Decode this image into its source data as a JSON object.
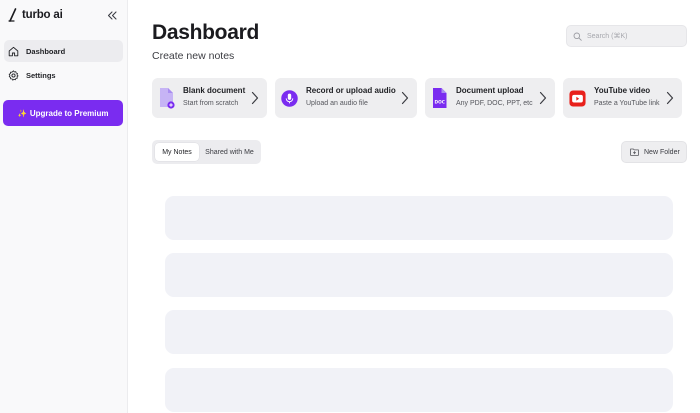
{
  "brand": {
    "name": "turbo ai"
  },
  "sidebar": {
    "items": [
      {
        "label": "Dashboard",
        "icon": "home-icon",
        "active": true
      },
      {
        "label": "Settings",
        "icon": "gear-icon",
        "active": false
      }
    ],
    "upgrade_label": "Upgrade to Premium",
    "upgrade_icon": "sparkle-icon"
  },
  "header": {
    "title": "Dashboard",
    "subtitle": "Create new notes",
    "search_placeholder": "Search (⌘K)"
  },
  "create_cards": [
    {
      "title": "Blank document",
      "desc": "Start from scratch",
      "icon": "blank-document-icon"
    },
    {
      "title": "Record or upload audio",
      "desc": "Upload an audio file",
      "icon": "microphone-icon"
    },
    {
      "title": "Document upload",
      "desc": "Any PDF, DOC, PPT, etc",
      "icon": "document-upload-icon"
    },
    {
      "title": "YouTube video",
      "desc": "Paste a YouTube link",
      "icon": "youtube-icon"
    }
  ],
  "tabs": [
    {
      "label": "My Notes",
      "active": true
    },
    {
      "label": "Shared with Me",
      "active": false
    }
  ],
  "new_folder_label": "New Folder",
  "colors": {
    "accent": "#7a2cf0",
    "youtube": "#e8201b",
    "skeleton": "#f1f2f7"
  },
  "loading_placeholders": 4
}
